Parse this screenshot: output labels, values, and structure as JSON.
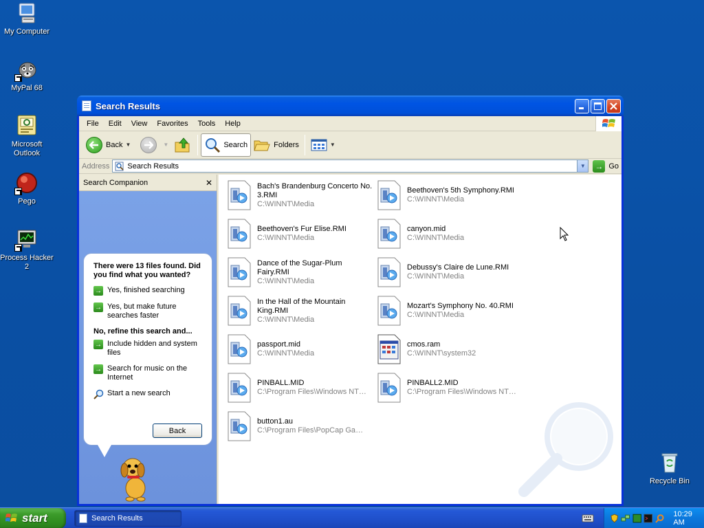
{
  "desktop": {
    "icons": [
      {
        "label": "My Computer",
        "icon": "computer-icon"
      },
      {
        "label": "MyPal 68",
        "icon": "raccoon-icon"
      },
      {
        "label": "Microsoft Outlook",
        "icon": "outlook-icon"
      },
      {
        "label": "Pego",
        "icon": "red-orb-icon"
      },
      {
        "label": "Process Hacker 2",
        "icon": "monitor-icon"
      },
      {
        "label": "Recycle Bin",
        "icon": "recycle-bin-icon"
      }
    ]
  },
  "window": {
    "title": "Search Results",
    "menu": [
      "File",
      "Edit",
      "View",
      "Favorites",
      "Tools",
      "Help"
    ],
    "toolbar": {
      "back_label": "Back",
      "search_label": "Search",
      "folders_label": "Folders"
    },
    "address": {
      "label": "Address",
      "value": "Search Results",
      "go_label": "Go"
    }
  },
  "companion": {
    "title": "Search Companion",
    "close_glyph": "✕",
    "found_text": "There were 13 files found. Did you find what you wanted?",
    "options": [
      "Yes, finished searching",
      "Yes, but make future searches faster"
    ],
    "refine_heading": "No, refine this search and...",
    "refine_options": [
      "Include hidden and system files",
      "Search for music on the Internet"
    ],
    "new_search": "Start a new search",
    "back_button": "Back"
  },
  "results": {
    "files": [
      {
        "name": "Bach's Brandenburg Concerto No. 3.RMI",
        "path": "C:\\WINNT\\Media",
        "type": "media"
      },
      {
        "name": "Beethoven's 5th Symphony.RMI",
        "path": "C:\\WINNT\\Media",
        "type": "media"
      },
      {
        "name": "Beethoven's Fur Elise.RMI",
        "path": "C:\\WINNT\\Media",
        "type": "media"
      },
      {
        "name": "canyon.mid",
        "path": "C:\\WINNT\\Media",
        "type": "media"
      },
      {
        "name": "Dance of the Sugar-Plum Fairy.RMI",
        "path": "C:\\WINNT\\Media",
        "type": "media"
      },
      {
        "name": "Debussy's Claire de Lune.RMI",
        "path": "C:\\WINNT\\Media",
        "type": "media"
      },
      {
        "name": "In the Hall of the Mountain King.RMI",
        "path": "C:\\WINNT\\Media",
        "type": "media"
      },
      {
        "name": "Mozart's Symphony No. 40.RMI",
        "path": "C:\\WINNT\\Media",
        "type": "media"
      },
      {
        "name": "passport.mid",
        "path": "C:\\WINNT\\Media",
        "type": "media"
      },
      {
        "name": "cmos.ram",
        "path": "C:\\WINNT\\system32",
        "type": "app"
      },
      {
        "name": "PINBALL.MID",
        "path": "C:\\Program Files\\Windows NT\\...",
        "type": "media"
      },
      {
        "name": "PINBALL2.MID",
        "path": "C:\\Program Files\\Windows NT\\...",
        "type": "media"
      },
      {
        "name": "button1.au",
        "path": "C:\\Program Files\\PopCap Gam...",
        "type": "media"
      }
    ]
  },
  "taskbar": {
    "start_label": "start",
    "task_label": "Search Results",
    "clock": "10:29 AM"
  },
  "colors": {
    "desktop": "#0a50a6",
    "title_bar": "#0054e3",
    "start_button": "#3c9b2b",
    "companion_panel": "#7a9ee5"
  }
}
